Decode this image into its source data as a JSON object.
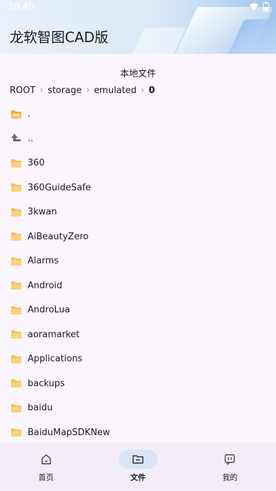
{
  "status_bar": {
    "time": "10:40"
  },
  "header": {
    "app_title": "龙软智图CAD版"
  },
  "page_title": "本地文件",
  "breadcrumb": [
    "ROOT",
    "storage",
    "emulated",
    "0"
  ],
  "files": [
    {
      "name": ".",
      "icon": "folder-current-icon"
    },
    {
      "name": "..",
      "icon": "parent-up-icon"
    },
    {
      "name": "360",
      "icon": "folder-icon"
    },
    {
      "name": "360GuideSafe",
      "icon": "folder-icon"
    },
    {
      "name": "3kwan",
      "icon": "folder-icon"
    },
    {
      "name": "AiBeautyZero",
      "icon": "folder-icon"
    },
    {
      "name": "Alarms",
      "icon": "folder-icon"
    },
    {
      "name": "Android",
      "icon": "folder-icon"
    },
    {
      "name": "AndroLua",
      "icon": "folder-icon"
    },
    {
      "name": "aoramarket",
      "icon": "folder-icon"
    },
    {
      "name": "Applications",
      "icon": "folder-icon"
    },
    {
      "name": "backups",
      "icon": "folder-icon"
    },
    {
      "name": "baidu",
      "icon": "folder-icon"
    },
    {
      "name": "BaiduMapSDKNew",
      "icon": "folder-icon"
    }
  ],
  "bottom_nav": [
    {
      "label": "首页",
      "icon": "home-icon",
      "active": false
    },
    {
      "label": "文件",
      "icon": "files-icon",
      "active": true
    },
    {
      "label": "我的",
      "icon": "profile-icon",
      "active": false
    }
  ],
  "colors": {
    "accent": "#d8e4f8",
    "folder": "#f6c15b",
    "background": "#fbf6fe"
  }
}
